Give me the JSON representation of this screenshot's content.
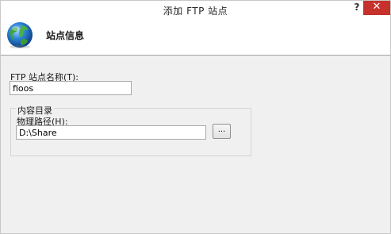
{
  "window": {
    "title": "添加 FTP 站点",
    "help_label": "?",
    "close_label": "✕"
  },
  "header": {
    "title": "站点信息",
    "icon": "globe-icon"
  },
  "form": {
    "site_name_label": "FTP 站点名称(T):",
    "site_name_value": "fioos",
    "group_title": "内容目录",
    "physical_path_label": "物理路径(H):",
    "physical_path_value": "D:\\Share",
    "browse_label": "..."
  },
  "colors": {
    "close_button": "#c7312b",
    "content_background": "#f0f0f0"
  }
}
